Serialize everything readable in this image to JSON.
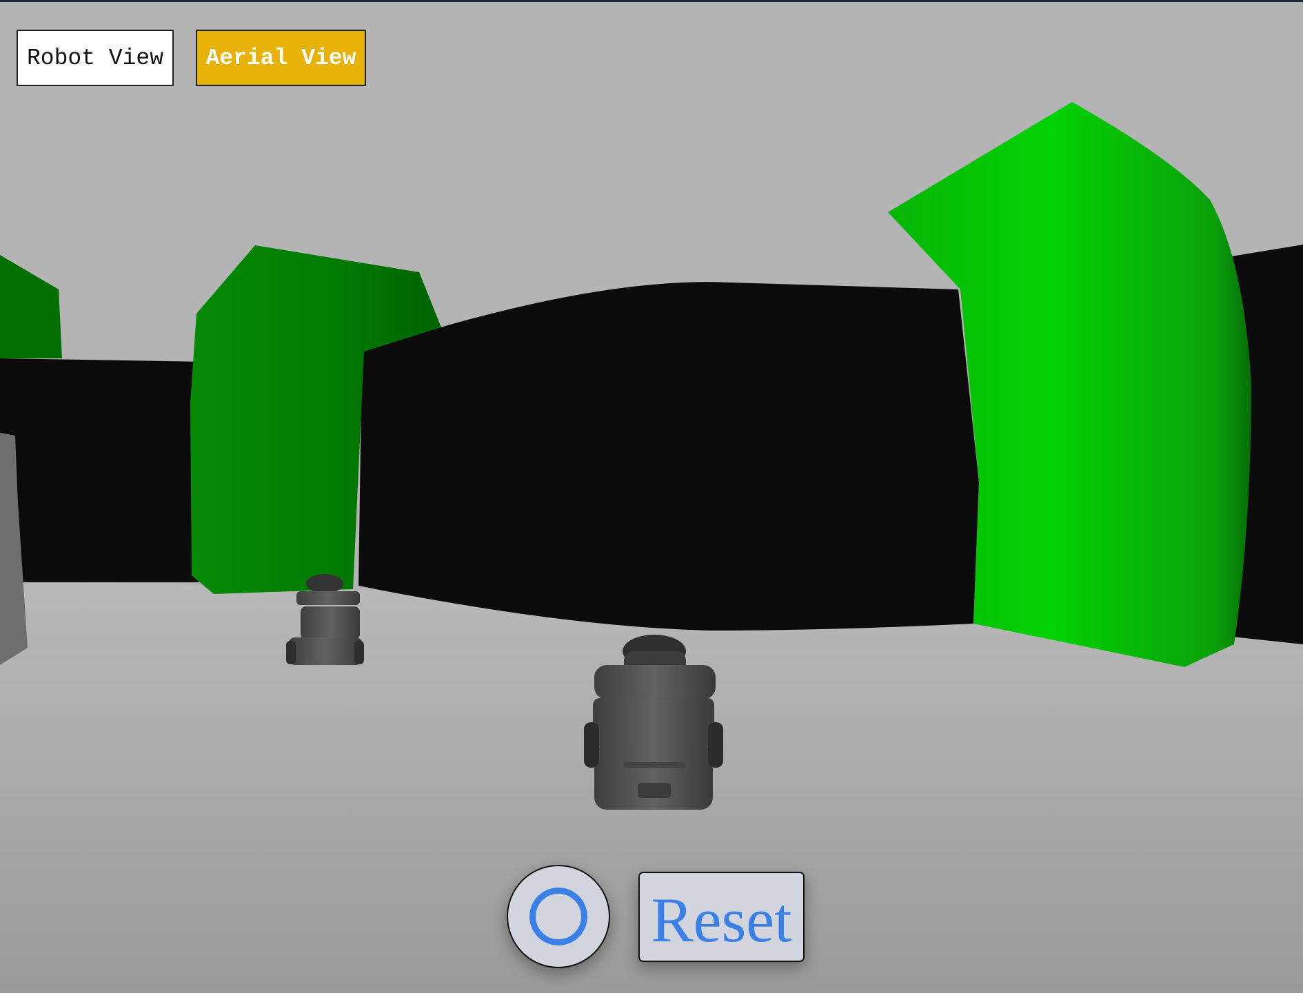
{
  "toolbar": {
    "robot_view_label": "Robot View",
    "aerial_view_label": "Aerial View",
    "active_view": "Aerial View"
  },
  "controls": {
    "record_icon": "circle-icon",
    "reset_label": "Reset"
  },
  "colors": {
    "sky": "#b4b4b4",
    "floor": "#a0a0a0",
    "wall": "#0b0b0b",
    "green_dark": "#017701",
    "green_bright": "#04cf04",
    "robot": "#555555",
    "accent_active": "#e8b309",
    "button_text_blue": "#3a80e6"
  }
}
